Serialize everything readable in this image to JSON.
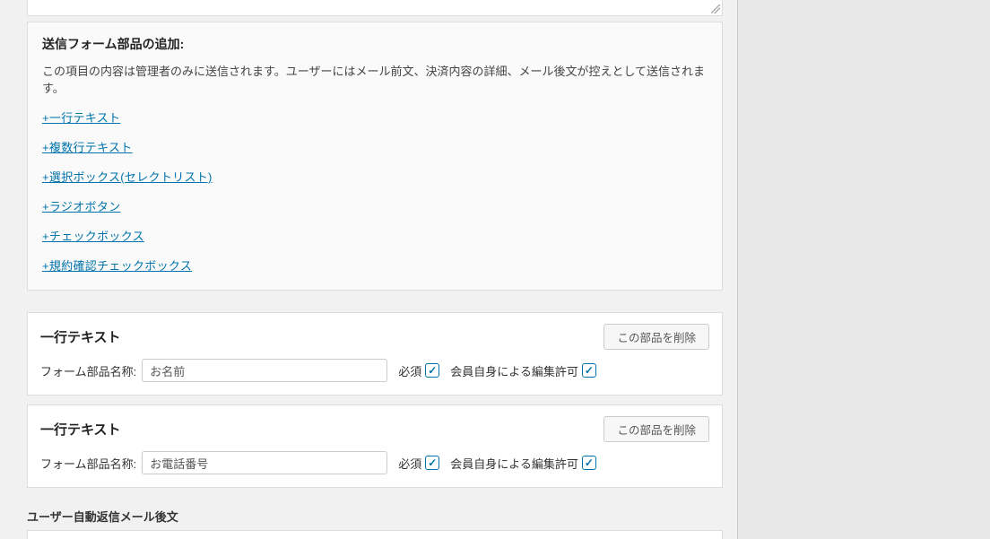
{
  "addPartsPanel": {
    "title": "送信フォーム部品の追加:",
    "note": "この項目の内容は管理者のみに送信されます。ユーザーにはメール前文、決済内容の詳細、メール後文が控えとして送信されます。",
    "links": {
      "singleLine": "+一行テキスト",
      "multiLine": "+複数行テキスト",
      "selectBox": "+選択ボックス(セレクトリスト)",
      "radio": "+ラジオボタン",
      "checkbox": "+チェックボックス",
      "termsCheckbox": "+規約確認チェックボックス"
    }
  },
  "parts": [
    {
      "typeLabel": "一行テキスト",
      "deleteLabel": "この部品を削除",
      "nameLabel": "フォーム部品名称:",
      "nameValue": "お名前",
      "requiredLabel": "必須",
      "requiredChecked": true,
      "editableLabel": "会員自身による編集許可",
      "editableChecked": true
    },
    {
      "typeLabel": "一行テキスト",
      "deleteLabel": "この部品を削除",
      "nameLabel": "フォーム部品名称:",
      "nameValue": "お電話番号",
      "requiredLabel": "必須",
      "requiredChecked": true,
      "editableLabel": "会員自身による編集許可",
      "editableChecked": true
    }
  ],
  "bottomSection": {
    "label": "ユーザー自動返信メール後文"
  }
}
